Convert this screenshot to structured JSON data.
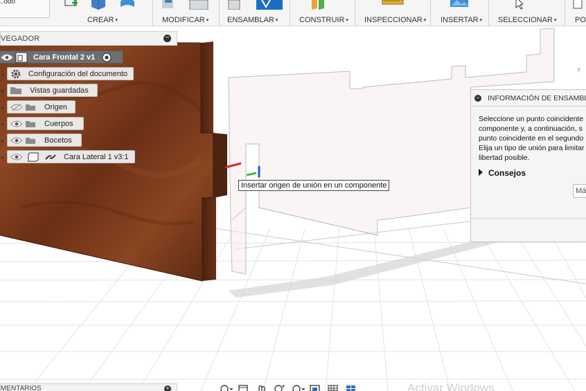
{
  "toolbar": {
    "partial_button_text": "...odo",
    "groups": [
      {
        "label": "CREAR",
        "icons": [
          "sketch-create-icon",
          "box-icon",
          "form-icon"
        ]
      },
      {
        "label": "MODIFICAR",
        "icons": [
          "press-pull-icon",
          "fillet-icon"
        ]
      },
      {
        "label": "ENSAMBLAR",
        "icons": [
          "new-component-icon",
          "joint-icon"
        ]
      },
      {
        "label": "CONSTRUIR",
        "icons": [
          "offset-plane-icon"
        ]
      },
      {
        "label": "INSPECCIONAR",
        "icons": [
          "measure-icon"
        ]
      },
      {
        "label": "INSERTAR",
        "icons": [
          "insert-image-icon"
        ]
      },
      {
        "label": "SELECCIONAR",
        "icons": [
          "select-arrow-icon"
        ]
      },
      {
        "label": "PO",
        "icons": [
          "position-icon"
        ]
      }
    ],
    "caret": "▾"
  },
  "browser": {
    "title": "VEGADOR",
    "collapse": "−",
    "root": {
      "label": "Cara Frontal 2 v1",
      "icons": [
        "eye-icon",
        "component-icon",
        "activate-radio-icon"
      ]
    },
    "items": [
      {
        "label": "Configuración del documento",
        "icon": "gear-icon",
        "visible": null
      },
      {
        "label": "Vistas guardadas",
        "icon": "folder-icon",
        "visible": null
      },
      {
        "label": "Origen",
        "icon": "folder-icon",
        "visible": false
      },
      {
        "label": "Cuerpos",
        "icon": "folder-icon",
        "visible": true
      },
      {
        "label": "Bocetos",
        "icon": "folder-icon",
        "visible": true
      },
      {
        "label": "Cara Lateral 1 v3:1",
        "icon": "link-icon",
        "visible": true
      }
    ]
  },
  "tooltip": {
    "text": "Insertar origen de unión en un componente"
  },
  "info_panel": {
    "title": "INFORMACIÓN DE ENSAMBLA",
    "lines": [
      "Seleccione un punto coincidente",
      "componente y, a continuación, s",
      "punto coincidente en el segundo",
      "Elija un tipo de unión para limitar",
      "libertad posible."
    ],
    "tips_label": "Consejos",
    "more_button": "Má"
  },
  "comments": {
    "title": "MENTARIOS",
    "collapse": "+"
  },
  "navbar_icons": [
    "orbit-icon",
    "pan-icon",
    "look-at-icon",
    "zoom-icon",
    "fit-icon",
    "display-settings-icon",
    "grid-icon",
    "viewports-icon"
  ],
  "watermark": "Activar Windows",
  "colors": {
    "wood_dark": "#5a2a14",
    "wood_mid": "#7a3d1d",
    "accent_blue": "#1b6fc2",
    "panel_bg": "#f5f5f5",
    "root_node_bg": "#6f6f6f"
  }
}
